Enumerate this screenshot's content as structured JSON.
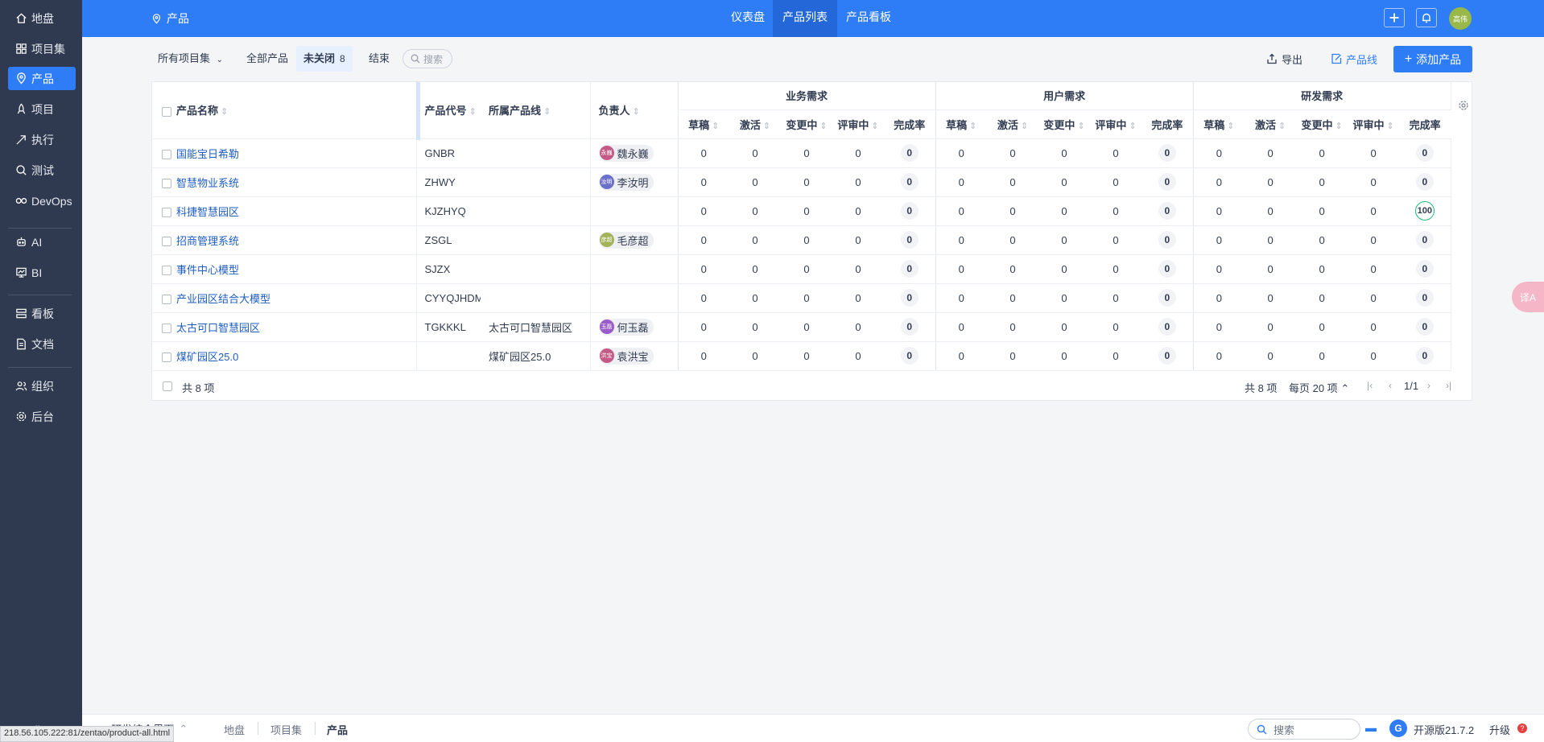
{
  "sidebar": {
    "items": [
      {
        "label": "地盘",
        "icon": "home-icon"
      },
      {
        "label": "项目集",
        "icon": "grid-icon"
      },
      {
        "label": "产品",
        "icon": "map-pin-icon"
      },
      {
        "label": "项目",
        "icon": "rocket-icon"
      },
      {
        "label": "执行",
        "icon": "bolt-icon"
      },
      {
        "label": "测试",
        "icon": "magnifier-icon"
      },
      {
        "label": "DevOps",
        "icon": "infinity-icon"
      },
      {
        "label": "AI",
        "icon": "robot-icon"
      },
      {
        "label": "BI",
        "icon": "chart-icon"
      },
      {
        "label": "看板",
        "icon": "kanban-icon"
      },
      {
        "label": "文档",
        "icon": "document-icon"
      },
      {
        "label": "组织",
        "icon": "users-icon"
      },
      {
        "label": "后台",
        "icon": "gear-icon"
      }
    ],
    "active_index": 2
  },
  "topbar": {
    "crumb": "产品",
    "tabs": [
      "仪表盘",
      "产品列表",
      "产品看板"
    ],
    "active_tab": 1,
    "avatar_text": "高伟"
  },
  "toolbar": {
    "program_select": "所有项目集",
    "all_products": "全部产品",
    "unclosed": "未关闭",
    "unclosed_count": "8",
    "closed": "结束",
    "search_placeholder": "搜索",
    "export": "导出",
    "product_line": "产品线",
    "add_product": "添加产品"
  },
  "table": {
    "headers": {
      "name": "产品名称",
      "code": "产品代号",
      "line": "所属产品线",
      "owner": "负责人",
      "groups": [
        "业务需求",
        "用户需求",
        "研发需求"
      ],
      "sub": [
        "草稿",
        "激活",
        "变更中",
        "评审中",
        "完成率"
      ]
    },
    "rows": [
      {
        "name": "国能宝日希勒",
        "code": "GNBR",
        "line": "",
        "owner": "魏永巍",
        "owner_av": "永巍",
        "owner_color": "#c45a86",
        "vals": [
          "0",
          "0",
          "0",
          "0",
          "0",
          "0",
          "0",
          "0",
          "0",
          "0",
          "0",
          "0",
          "0",
          "0",
          "0"
        ]
      },
      {
        "name": "智慧物业系统",
        "code": "ZHWY",
        "line": "",
        "owner": "李汝明",
        "owner_av": "汝明",
        "owner_color": "#6a6fc9",
        "vals": [
          "0",
          "0",
          "0",
          "0",
          "0",
          "0",
          "0",
          "0",
          "0",
          "0",
          "0",
          "0",
          "0",
          "0",
          "0"
        ]
      },
      {
        "name": "科捷智慧园区",
        "code": "KJZHYQ",
        "line": "",
        "owner": "",
        "owner_av": "",
        "owner_color": "",
        "vals": [
          "0",
          "0",
          "0",
          "0",
          "0",
          "0",
          "0",
          "0",
          "0",
          "0",
          "0",
          "0",
          "0",
          "0",
          "100"
        ]
      },
      {
        "name": "招商管理系统",
        "code": "ZSGL",
        "line": "",
        "owner": "毛彦超",
        "owner_av": "彦超",
        "owner_color": "#a4b35a",
        "vals": [
          "0",
          "0",
          "0",
          "0",
          "0",
          "0",
          "0",
          "0",
          "0",
          "0",
          "0",
          "0",
          "0",
          "0",
          "0"
        ]
      },
      {
        "name": "事件中心模型",
        "code": "SJZX",
        "line": "",
        "owner": "",
        "owner_av": "",
        "owner_color": "",
        "vals": [
          "0",
          "0",
          "0",
          "0",
          "0",
          "0",
          "0",
          "0",
          "0",
          "0",
          "0",
          "0",
          "0",
          "0",
          "0"
        ]
      },
      {
        "name": "产业园区结合大模型",
        "code": "CYYQJHDM",
        "line": "",
        "owner": "",
        "owner_av": "",
        "owner_color": "",
        "vals": [
          "0",
          "0",
          "0",
          "0",
          "0",
          "0",
          "0",
          "0",
          "0",
          "0",
          "0",
          "0",
          "0",
          "0",
          "0"
        ]
      },
      {
        "name": "太古可口智慧园区",
        "code": "TGKKKL",
        "line": "太古可口智慧园区",
        "owner": "何玉磊",
        "owner_av": "玉磊",
        "owner_color": "#9a5cc8",
        "vals": [
          "0",
          "0",
          "0",
          "0",
          "0",
          "0",
          "0",
          "0",
          "0",
          "0",
          "0",
          "0",
          "0",
          "0",
          "0"
        ]
      },
      {
        "name": "煤矿园区25.0",
        "code": "",
        "line": "煤矿园区25.0",
        "owner": "袁洪宝",
        "owner_av": "洪宝",
        "owner_color": "#c45a86",
        "vals": [
          "0",
          "0",
          "0",
          "0",
          "0",
          "0",
          "0",
          "0",
          "0",
          "0",
          "0",
          "0",
          "0",
          "0",
          "0"
        ]
      }
    ]
  },
  "pager": {
    "total_left": "共 8 项",
    "total_right": "共 8 项",
    "per_page": "每页 20 项",
    "page": "1/1"
  },
  "bottombar": {
    "app_switch": "研发综合界面",
    "breadcrumbs": [
      "地盘",
      "项目集",
      "产品"
    ],
    "search_placeholder": "搜索",
    "version": "开源版21.7.2",
    "upgrade": "升级"
  },
  "status_url": "218.56.105.222:81/zentao/product-all.html",
  "colors": {
    "brand": "#2e7cf6",
    "sidebar": "#2f3a50",
    "success": "#19b87a"
  }
}
